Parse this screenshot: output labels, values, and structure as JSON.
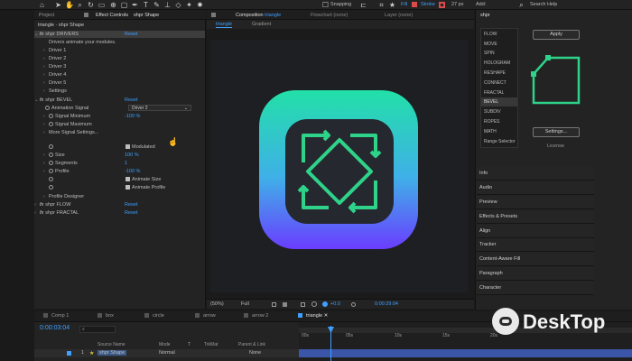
{
  "toolbar": {
    "snapping": "Snapping",
    "fill": "Fill",
    "stroke": "Stroke",
    "stroke_px": "27 px",
    "add": "Add:",
    "search_help": "Search Help"
  },
  "left_panel": {
    "tab_project": "Project",
    "tab_effect_controls": "Effect Controls",
    "tab_effect_layer": "shpr Shape",
    "breadcrumb": "triangle · shpr Shape",
    "rows": [
      {
        "text": "shpr DRIVERS",
        "value": "Reset"
      },
      {
        "text": "Drivers animate your modules.",
        "value": ""
      },
      {
        "text": "Driver 1",
        "value": ""
      },
      {
        "text": "Driver 2",
        "value": ""
      },
      {
        "text": "Driver 3",
        "value": ""
      },
      {
        "text": "Driver 4",
        "value": ""
      },
      {
        "text": "Driver 5",
        "value": ""
      },
      {
        "text": "Settings",
        "value": ""
      },
      {
        "text": "shpr BEVEL",
        "value": "Reset"
      },
      {
        "text": "Animation Signal",
        "value": "Driver 2"
      },
      {
        "text": "Signal Minimum",
        "value": "-100 %"
      },
      {
        "text": "Signal Maximum",
        "value": ""
      },
      {
        "text": "More Signal Settings...",
        "value": ""
      },
      {
        "text": "",
        "value": "Modulated"
      },
      {
        "text": "Size",
        "value": "100 %"
      },
      {
        "text": "Segments",
        "value": "1"
      },
      {
        "text": "Profile",
        "value": "-100 %"
      },
      {
        "text": "",
        "value": "Animate Size"
      },
      {
        "text": "",
        "value": "Animate Profile"
      },
      {
        "text": "Profile Designer",
        "value": ""
      },
      {
        "text": "shpr FLOW",
        "value": "Reset"
      },
      {
        "text": "shpr FRACTAL",
        "value": "Reset"
      }
    ]
  },
  "composition": {
    "tab_label": "Composition",
    "comp_name": "triangle",
    "flowchart": "Flowchart (none)",
    "layer": "Layer (none)",
    "sub_tabs": [
      "triangle",
      "Gradient"
    ],
    "zoom": "(50%)",
    "quality": "Full",
    "exposure": "+0.0",
    "timecode": "0:00:29:04"
  },
  "right_panel": {
    "title": "shpr",
    "modules": [
      "FLOW",
      "MOVE",
      "SPIN",
      "HOLOGRAM",
      "RESHAPE",
      "CONNECT",
      "FRACTAL",
      "BEVEL",
      "SUBDIV",
      "ROPES",
      "MATH",
      "Range Selector"
    ],
    "active_module": "BEVEL",
    "apply_label": "Apply",
    "settings_label": "Settings...",
    "license_label": "License",
    "sections": [
      "Info",
      "Audio",
      "Preview",
      "Effects & Presets",
      "Align",
      "Tracker",
      "Content-Aware Fill",
      "Paragraph",
      "Character"
    ]
  },
  "timeline": {
    "tabs": [
      "Comp 1",
      "box",
      "circle",
      "arrow",
      "arrow 2",
      "triangle"
    ],
    "timecode": "0:00:03:04",
    "columns": [
      "Source Name",
      "Mode",
      "T",
      "TrkMat",
      "Parent & Link"
    ],
    "layer_num": "1",
    "layer_name": "shpr Shape",
    "layer_mode": "Normal",
    "layer_parent": "None",
    "ruler": [
      "00s",
      "05s",
      "10s",
      "15s",
      "20s"
    ]
  },
  "watermark": "DeskTop",
  "colors": {
    "accent_blue": "#3fa0ff",
    "shape_green": "#2ed389",
    "gradient_top": "#22e0a8",
    "gradient_bottom": "#6a3dff",
    "timeline_bar": "#3b56a8"
  }
}
